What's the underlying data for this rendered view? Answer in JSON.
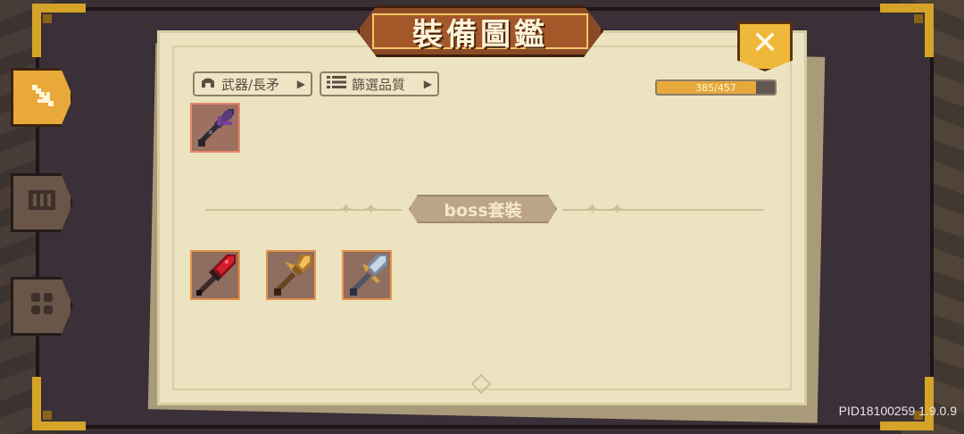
{
  "title": "裝備圖鑑",
  "close_label": "✕",
  "side_tabs": [
    {
      "name": "weapon",
      "icon": "sword-icon",
      "active": true
    },
    {
      "name": "armor",
      "icon": "armor-icon",
      "active": false
    },
    {
      "name": "accessory",
      "icon": "clover-icon",
      "active": false
    }
  ],
  "filters": {
    "type_label": "武器/長矛",
    "quality_label": "篩選品質"
  },
  "collection": {
    "collected": 385,
    "total": 457,
    "progress_text": "385/457"
  },
  "section_label": "boss套裝",
  "items_top": [
    {
      "name": "purple-spear",
      "rarity_color": "#e8866e"
    }
  ],
  "items_boss": [
    {
      "name": "crimson-spear",
      "rarity_color": "#e7934a"
    },
    {
      "name": "golden-halberd",
      "rarity_color": "#e7934a"
    },
    {
      "name": "silver-trident",
      "rarity_color": "#e7934a"
    }
  ],
  "version": "PID18100259 1.9.0.9",
  "colors": {
    "accent": "#e7a93c",
    "paper": "#ece4c0",
    "frame": "#3b2f38",
    "gold": "#d4a328"
  }
}
